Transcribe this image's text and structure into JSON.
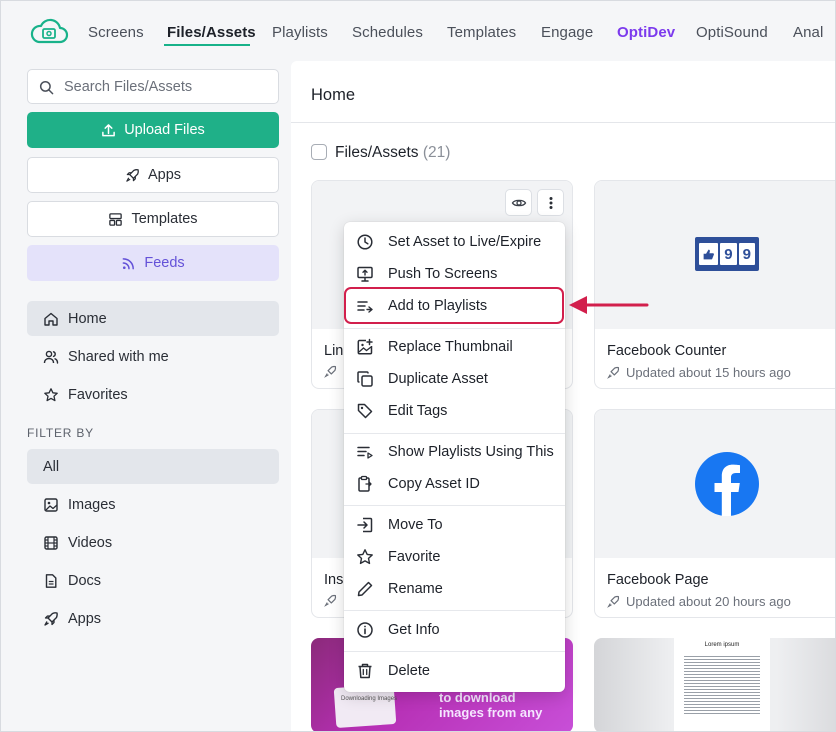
{
  "nav": {
    "items": [
      "Screens",
      "Files/Assets",
      "Playlists",
      "Schedules",
      "Templates",
      "Engage",
      "OptiDev",
      "OptiSound",
      "Anal"
    ],
    "active": "Files/Assets"
  },
  "sidebar": {
    "search_placeholder": "Search Files/Assets",
    "upload_label": "Upload Files",
    "apps_label": "Apps",
    "templates_label": "Templates",
    "feeds_label": "Feeds",
    "nav": [
      "Home",
      "Shared with me",
      "Favorites"
    ],
    "filter_label": "FILTER BY",
    "filters": [
      "All",
      "Images",
      "Videos",
      "Docs",
      "Apps"
    ]
  },
  "main": {
    "title": "Home",
    "section_label": "Files/Assets",
    "section_count": "(21)"
  },
  "cards": [
    {
      "title": "Lin",
      "subtitle": ""
    },
    {
      "title": "Facebook Counter",
      "subtitle": "Updated about 15 hours ago"
    },
    {
      "title": "Ins",
      "subtitle": ""
    },
    {
      "title": "Facebook Page",
      "subtitle": "Updated about 20 hours ago"
    }
  ],
  "thumb_text": {
    "fb_counter_digits": [
      "9",
      "9"
    ],
    "purple_card_text": "to download images from any",
    "purple_card_small": "Downloading Images",
    "doc_card_title": "Lorem ipsum"
  },
  "menu": {
    "items": [
      "Set Asset to Live/Expire",
      "Push To Screens",
      "Add to Playlists",
      "Replace Thumbnail",
      "Duplicate Asset",
      "Edit Tags",
      "Show Playlists Using This",
      "Copy Asset ID",
      "Move To",
      "Favorite",
      "Rename",
      "Get Info",
      "Delete"
    ],
    "highlighted": "Add to Playlists"
  },
  "colors": {
    "accent_green": "#1fb088",
    "feeds_bg": "#e4e2fa",
    "feeds_text": "#6452d8",
    "optidev_purple": "#7c3aed",
    "highlight_red": "#d21f4c",
    "facebook_blue": "#1877f2"
  }
}
